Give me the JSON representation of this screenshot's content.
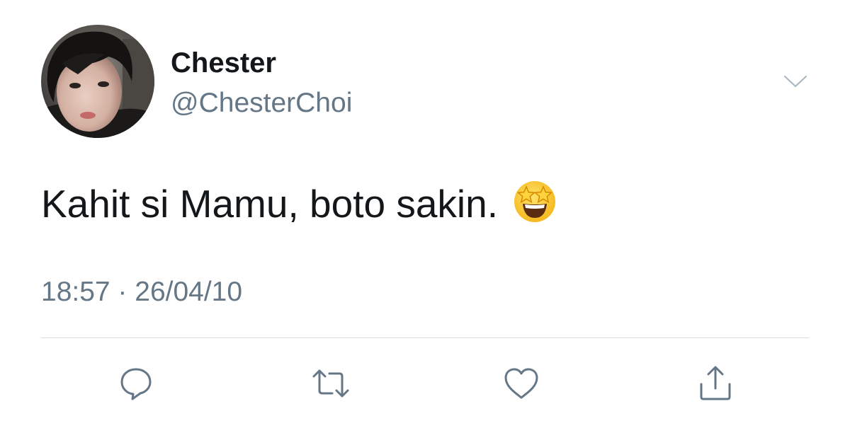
{
  "tweet": {
    "display_name": "Chester",
    "handle": "@ChesterChoi",
    "text": "Kahit si Mamu, boto sakin.",
    "emoji": "star-struck-emoji",
    "timestamp": "18:57 · 26/04/10"
  },
  "actions": {
    "reply_icon": "speech-bubble-icon",
    "retweet_icon": "retweet-arrows-icon",
    "like_icon": "heart-icon",
    "share_icon": "share-upload-icon"
  },
  "colors": {
    "text_primary": "#14171a",
    "text_secondary": "#657786",
    "icon_gray": "#657786",
    "divider": "#d8dee3",
    "background": "#ffffff"
  }
}
